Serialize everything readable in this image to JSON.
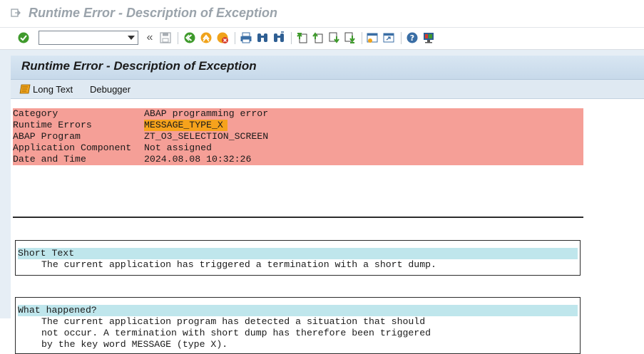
{
  "window": {
    "title": "Runtime Error - Description of Exception"
  },
  "toolbar": {
    "command_field_value": "",
    "icons": [
      "enter-icon",
      "dropdown-arrow-icon",
      "history-back-icon",
      "save-icon",
      "back-icon",
      "exit-icon",
      "cancel-icon",
      "print-icon",
      "find-icon",
      "find-next-icon",
      "first-page-icon",
      "previous-page-icon",
      "next-page-icon",
      "last-page-icon",
      "create-session-icon",
      "shortcut-icon",
      "help-icon",
      "customize-layout-icon"
    ],
    "history_glyph": "«"
  },
  "content": {
    "title": "Runtime Error - Description of Exception",
    "buttons": {
      "long_text": "Long Text",
      "debugger": "Debugger"
    }
  },
  "info": [
    {
      "key": "Category",
      "value": "ABAP programming error",
      "highlight": false
    },
    {
      "key": "Runtime Errors",
      "value": "MESSAGE_TYPE_X",
      "highlight": true
    },
    {
      "key": "ABAP Program",
      "value": "ZT_O3_SELECTION_SCREEN",
      "highlight": false
    },
    {
      "key": "Application Component",
      "value": "Not assigned",
      "highlight": false
    },
    {
      "key": "Date and Time",
      "value": "2024.08.08 10:32:26",
      "highlight": false
    }
  ],
  "sections": {
    "short_text": {
      "heading": "Short Text",
      "lines": [
        "The current application has triggered a termination with a short dump."
      ]
    },
    "what_happened": {
      "heading": "What happened?",
      "lines": [
        "The current application program has detected a situation that should",
        "not occur. A termination with short dump has therefore been triggered",
        "by the key word MESSAGE (type X)."
      ]
    }
  },
  "colors": {
    "info_background": "#f59f97",
    "highlight": "#f6a21c",
    "section_heading_background": "#bfe6ec",
    "content_title_bar": "#c7d9ea"
  }
}
